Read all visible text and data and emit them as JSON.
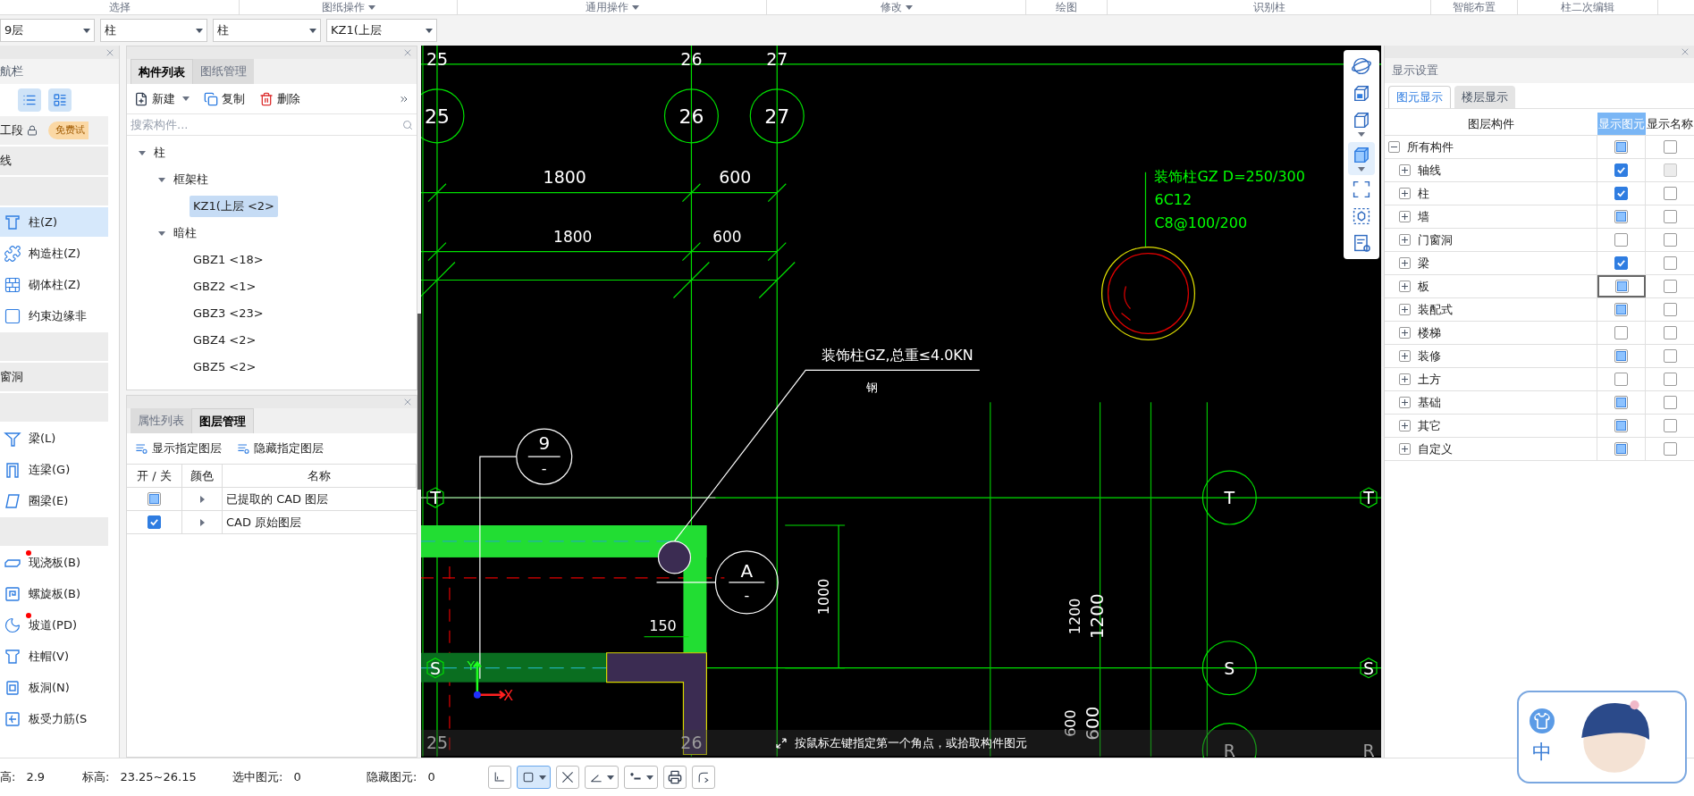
{
  "ribbon_groups": [
    {
      "label": "选择",
      "menu": false
    },
    {
      "label": "图纸操作",
      "menu": true
    },
    {
      "label": "通用操作",
      "menu": true
    },
    {
      "label": "修改",
      "menu": true
    },
    {
      "label": "绘图",
      "menu": false
    },
    {
      "label": "识别柱",
      "menu": false
    },
    {
      "label": "智能布置",
      "menu": false
    },
    {
      "label": "柱二次编辑",
      "menu": false
    }
  ],
  "selectors": [
    "9层",
    "柱",
    "柱",
    "KZ1(上层"
  ],
  "nav": {
    "title": "航栏",
    "view_modes": [
      {
        "selected": true
      },
      {
        "selected": true
      }
    ],
    "segment": {
      "label": "工段",
      "badge": "免费试"
    },
    "items": [
      {
        "kind": "header",
        "label": "线"
      },
      {
        "kind": "header"
      },
      {
        "kind": "item",
        "label": "柱(Z)",
        "selected": true,
        "dot": false
      },
      {
        "kind": "item",
        "label": "构造柱(Z)",
        "selected": false,
        "dot": false
      },
      {
        "kind": "item",
        "label": "砌体柱(Z)",
        "selected": false,
        "dot": false
      },
      {
        "kind": "item",
        "label": "约束边缘非",
        "selected": false,
        "dot": false
      },
      {
        "kind": "header"
      },
      {
        "kind": "header",
        "label": "窗洞"
      },
      {
        "kind": "header"
      },
      {
        "kind": "item",
        "label": "梁(L)",
        "selected": false,
        "dot": false
      },
      {
        "kind": "item",
        "label": "连梁(G)",
        "selected": false,
        "dot": false
      },
      {
        "kind": "item",
        "label": "圈梁(E)",
        "selected": false,
        "dot": false
      },
      {
        "kind": "header"
      },
      {
        "kind": "item",
        "label": "现浇板(B)",
        "selected": false,
        "dot": true
      },
      {
        "kind": "item",
        "label": "螺旋板(B)",
        "selected": false,
        "dot": false
      },
      {
        "kind": "item",
        "label": "坡道(PD)",
        "selected": false,
        "dot": true
      },
      {
        "kind": "item",
        "label": "柱帽(V)",
        "selected": false,
        "dot": false
      },
      {
        "kind": "item",
        "label": "板洞(N)",
        "selected": false,
        "dot": false
      },
      {
        "kind": "item",
        "label": "板受力筋(S",
        "selected": false,
        "dot": false
      }
    ]
  },
  "component_panel": {
    "tabs": [
      {
        "label": "构件列表",
        "selected": true
      },
      {
        "label": "图纸管理",
        "selected": false
      }
    ],
    "actions": [
      "新建",
      "复制",
      "删除"
    ],
    "search": {
      "placeholder": "搜索构件..."
    },
    "tree": [
      {
        "label": "柱",
        "expanded": true,
        "selected": false,
        "children": [
          {
            "label": "框架柱",
            "expanded": true,
            "selected": false,
            "children": [
              {
                "label": "KZ1(上层 <2>",
                "selected": true
              }
            ]
          },
          {
            "label": "暗柱",
            "expanded": true,
            "selected": false,
            "children": [
              {
                "label": "GBZ1 <18>",
                "selected": false
              },
              {
                "label": "GBZ2 <1>",
                "selected": false
              },
              {
                "label": "GBZ3 <23>",
                "selected": false
              },
              {
                "label": "GBZ4 <2>",
                "selected": false
              },
              {
                "label": "GBZ5 <2>",
                "selected": false
              }
            ]
          }
        ]
      }
    ]
  },
  "layer_panel": {
    "tabs": [
      {
        "label": "属性列表",
        "selected": false
      },
      {
        "label": "图层管理",
        "selected": true
      }
    ],
    "actions": [
      "显示指定图层",
      "隐藏指定图层"
    ],
    "columns": [
      "开 / 关",
      "颜色",
      "名称"
    ],
    "rows": [
      {
        "name": "已提取的 CAD 图层",
        "checked": false,
        "partial": true
      },
      {
        "name": "CAD 原始图层",
        "checked": true,
        "partial": false
      }
    ]
  },
  "canvas": {
    "top_axes": [
      "25",
      "26",
      "27"
    ],
    "axis_bubbles": [
      "25",
      "26",
      "27"
    ],
    "dimensions_upper": [
      "1800",
      "600"
    ],
    "dimensions_lower": [
      "1800",
      "600"
    ],
    "column_note": [
      "装饰柱GZ  D=250/300",
      "6C12",
      "C8@100/200"
    ],
    "leader_note": [
      "装饰柱GZ,总重≤4.0KN",
      "钢"
    ],
    "bubble_9": [
      "9",
      "-"
    ],
    "bubble_a": [
      "A",
      "-"
    ],
    "axis_t": [
      "T",
      "T",
      "T"
    ],
    "axis_s": [
      "S",
      "S",
      "S"
    ],
    "dimension_150": "150",
    "dimension_1000": "1000",
    "dimensions_1200": [
      "1200",
      "1200"
    ],
    "dimensions_600": [
      "600",
      "600"
    ],
    "bottom_axes": [
      "25",
      "26",
      "R",
      "R"
    ],
    "axis_x": "X",
    "axis_y": "Y",
    "prompt": "按鼠标左键指定第一个角点，或拾取构件图元",
    "tools": [
      {
        "selected": false,
        "menu": false
      },
      {
        "selected": false,
        "menu": false
      },
      {
        "selected": false,
        "menu": true
      },
      {
        "selected": true,
        "menu": true
      },
      {
        "selected": false,
        "menu": false
      },
      {
        "selected": false,
        "menu": false
      },
      {
        "selected": false,
        "menu": false
      }
    ]
  },
  "display_settings": {
    "title": "显示设置",
    "tabs": [
      {
        "label": "图元显示",
        "selected": true
      },
      {
        "label": "楼层显示",
        "selected": false
      }
    ],
    "columns": [
      {
        "label": "图层构件",
        "selected": false
      },
      {
        "label": "显示图元",
        "selected": true
      },
      {
        "label": "显示名称",
        "selected": false
      }
    ],
    "root": {
      "label": "所有构件",
      "expanded": true,
      "show_checked": false,
      "show_partial": true,
      "name_checked": false,
      "name_disabled": false,
      "focused": false
    },
    "rows": [
      {
        "label": "轴线",
        "expanded": false,
        "show_checked": true,
        "show_partial": false,
        "name_checked": false,
        "name_disabled": true,
        "focused": false
      },
      {
        "label": "柱",
        "expanded": false,
        "show_checked": true,
        "show_partial": false,
        "name_checked": false,
        "name_disabled": false,
        "focused": false
      },
      {
        "label": "墙",
        "expanded": false,
        "show_checked": false,
        "show_partial": true,
        "name_checked": false,
        "name_disabled": false,
        "focused": false
      },
      {
        "label": "门窗洞",
        "expanded": false,
        "show_checked": false,
        "show_partial": false,
        "name_checked": false,
        "name_disabled": false,
        "focused": false
      },
      {
        "label": "梁",
        "expanded": false,
        "show_checked": true,
        "show_partial": false,
        "name_checked": false,
        "name_disabled": false,
        "focused": false
      },
      {
        "label": "板",
        "expanded": false,
        "show_checked": false,
        "show_partial": true,
        "name_checked": false,
        "name_disabled": false,
        "focused": true
      },
      {
        "label": "装配式",
        "expanded": false,
        "show_checked": false,
        "show_partial": true,
        "name_checked": false,
        "name_disabled": false,
        "focused": false
      },
      {
        "label": "楼梯",
        "expanded": false,
        "show_checked": false,
        "show_partial": false,
        "name_checked": false,
        "name_disabled": false,
        "focused": false
      },
      {
        "label": "装修",
        "expanded": false,
        "show_checked": false,
        "show_partial": true,
        "name_checked": false,
        "name_disabled": false,
        "focused": false
      },
      {
        "label": "土方",
        "expanded": false,
        "show_checked": false,
        "show_partial": false,
        "name_checked": false,
        "name_disabled": false,
        "focused": false
      },
      {
        "label": "基础",
        "expanded": false,
        "show_checked": false,
        "show_partial": true,
        "name_checked": false,
        "name_disabled": false,
        "focused": false
      },
      {
        "label": "其它",
        "expanded": false,
        "show_checked": false,
        "show_partial": true,
        "name_checked": false,
        "name_disabled": false,
        "focused": false
      },
      {
        "label": "自定义",
        "expanded": false,
        "show_checked": false,
        "show_partial": true,
        "name_checked": false,
        "name_disabled": false,
        "focused": false
      }
    ]
  },
  "status": [
    {
      "label": "高:",
      "value": "2.9"
    },
    {
      "label": "标高:",
      "value": "23.25~26.15"
    },
    {
      "label": "选中图元:",
      "value": "0"
    },
    {
      "label": "隐藏图元:",
      "value": "0"
    }
  ],
  "snap_tools": [
    {
      "selected": false,
      "menu": false
    },
    {
      "selected": true,
      "menu": true
    },
    {
      "selected": false,
      "menu": false
    },
    {
      "selected": false,
      "menu": true
    },
    {
      "selected": false,
      "menu": true
    },
    {
      "selected": false,
      "menu": false
    },
    {
      "selected": false,
      "menu": false
    }
  ],
  "assistant": {
    "label": "中"
  }
}
